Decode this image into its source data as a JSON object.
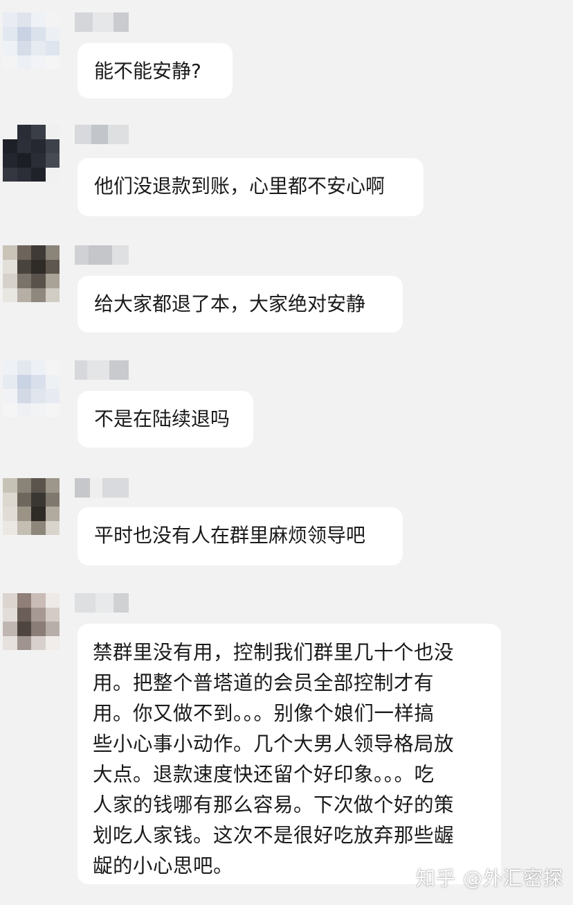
{
  "messages": [
    {
      "text": "能不能安静?"
    },
    {
      "text": "他们没退款到账，心里都不安心啊"
    },
    {
      "text": "给大家都退了本，大家绝对安静"
    },
    {
      "text": "不是在陆续退吗"
    },
    {
      "text": "平时也没有人在群里麻烦领导吧"
    },
    {
      "text": "禁群里没有用，控制我们群里几十个也没\n用。把整个普塔道的会员全部控制才有\n用。你又做不到。。。别像个娘们一样搞\n些小心事小动作。几个大男人领导格局放\n大点。退款速度快还留个好印象。。。吃\n人家的钱哪有那么容易。下次做个好的策\n划吃人家钱。这次不是很好吃放弃那些龌\n龊的小心思吧。"
    }
  ],
  "watermark": "知乎 @外汇密探"
}
